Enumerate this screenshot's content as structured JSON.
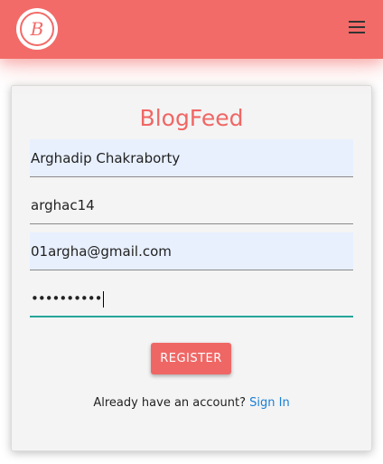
{
  "header": {
    "logo_letter": "B",
    "menu_icon": "hamburger-menu-icon",
    "brand_color": "#f26b68"
  },
  "form": {
    "title": "BlogFeed",
    "fields": {
      "full_name": "Arghadip Chakraborty",
      "username": "arghac14",
      "email": "01argha@gmail.com",
      "password_mask": "••••••••••"
    },
    "register_label": "REGISTER",
    "signin_prompt": "Already have an account?",
    "signin_link": "Sign In",
    "accent_color": "#26a69a",
    "link_color": "#1a7fd4"
  }
}
